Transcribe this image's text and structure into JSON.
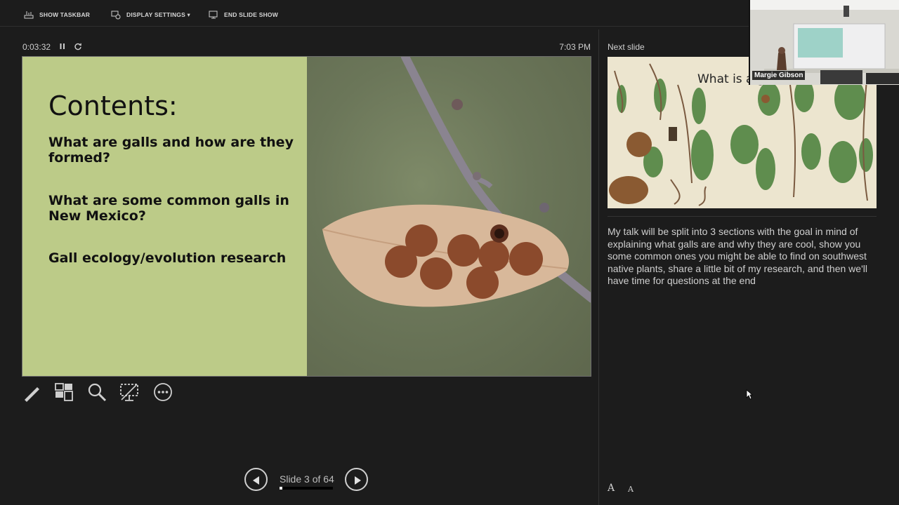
{
  "toolbar": {
    "show_taskbar": "SHOW TASKBAR",
    "display_settings": "DISPLAY SETTINGS ▾",
    "end_slide_show": "END SLIDE SHOW"
  },
  "presenter": {
    "elapsed_time": "0:03:32",
    "clock": "7:03 PM",
    "slide_counter": "Slide 3 of 64",
    "slide_progress": 0.0469
  },
  "current_slide": {
    "title": "Contents:",
    "bullets": [
      "What are galls and how are they formed?",
      "What are some common galls in New Mexico?",
      "Gall ecology/evolution research"
    ],
    "bg_color": "#bccb88"
  },
  "next_slide": {
    "label": "Next slide",
    "title_fragment": "What is a g"
  },
  "speaker_notes": "My talk will be split into 3 sections with the goal in mind of explaining what galls are and why they are cool, show you some common ones you might be able to find on southwest native plants, share a little bit of my research, and then we'll have time for questions at the end",
  "webcam": {
    "name": "Margie Gibson"
  },
  "font_controls": {
    "increase": "A",
    "decrease": "A"
  },
  "icons": {
    "taskbar": "taskbar-icon",
    "display": "display-settings-icon",
    "end": "end-show-icon",
    "pause": "pause-icon",
    "reset": "reset-icon",
    "pen": "pen-icon",
    "see_all_slides": "see-all-slides-icon",
    "zoom": "zoom-icon",
    "black_screen": "black-screen-icon",
    "more": "more-options-icon"
  }
}
